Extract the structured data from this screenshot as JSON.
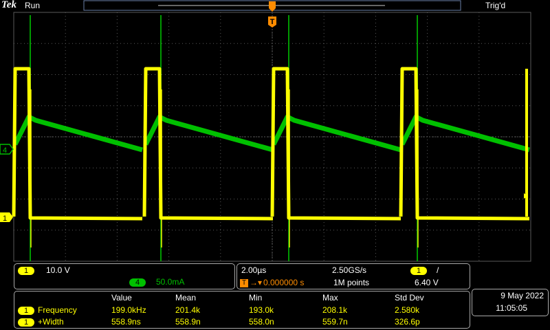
{
  "header": {
    "brand": "Tek",
    "status": "Run",
    "trigger_status": "Trig'd",
    "trigger_marker": "T"
  },
  "markers": {
    "ch4": "4",
    "ch1": "1"
  },
  "channels": {
    "ch1": {
      "number": "1",
      "scale": "10.0 V",
      "color": "#ffff00"
    },
    "ch4": {
      "number": "4",
      "scale": "50.0mA",
      "color": "#00c000"
    }
  },
  "timebase": {
    "time_per_div": "2.00µs",
    "sample_rate": "2.50GS/s",
    "trigger_position": "0.000000 s",
    "record_length": "1M points",
    "trigger_source": "1",
    "trigger_slope": "/",
    "trigger_level": "6.40 V"
  },
  "measurements": {
    "headers": [
      "Value",
      "Mean",
      "Min",
      "Max",
      "Std Dev"
    ],
    "rows": [
      {
        "channel": "1",
        "name": "Frequency",
        "value": "199.0kHz",
        "mean": "201.4k",
        "min": "193.0k",
        "max": "208.1k",
        "std": "2.580k"
      },
      {
        "channel": "1",
        "name": "+Width",
        "value": "558.9ns",
        "mean": "558.9n",
        "min": "558.0n",
        "max": "559.7n",
        "std": "326.6p"
      }
    ]
  },
  "datetime": {
    "date": "9 May  2022",
    "time": "11:05:05"
  },
  "colors": {
    "background": "#000000",
    "ch1": "#ffff00",
    "ch4": "#00c000",
    "grid": "#5a5a5a"
  }
}
